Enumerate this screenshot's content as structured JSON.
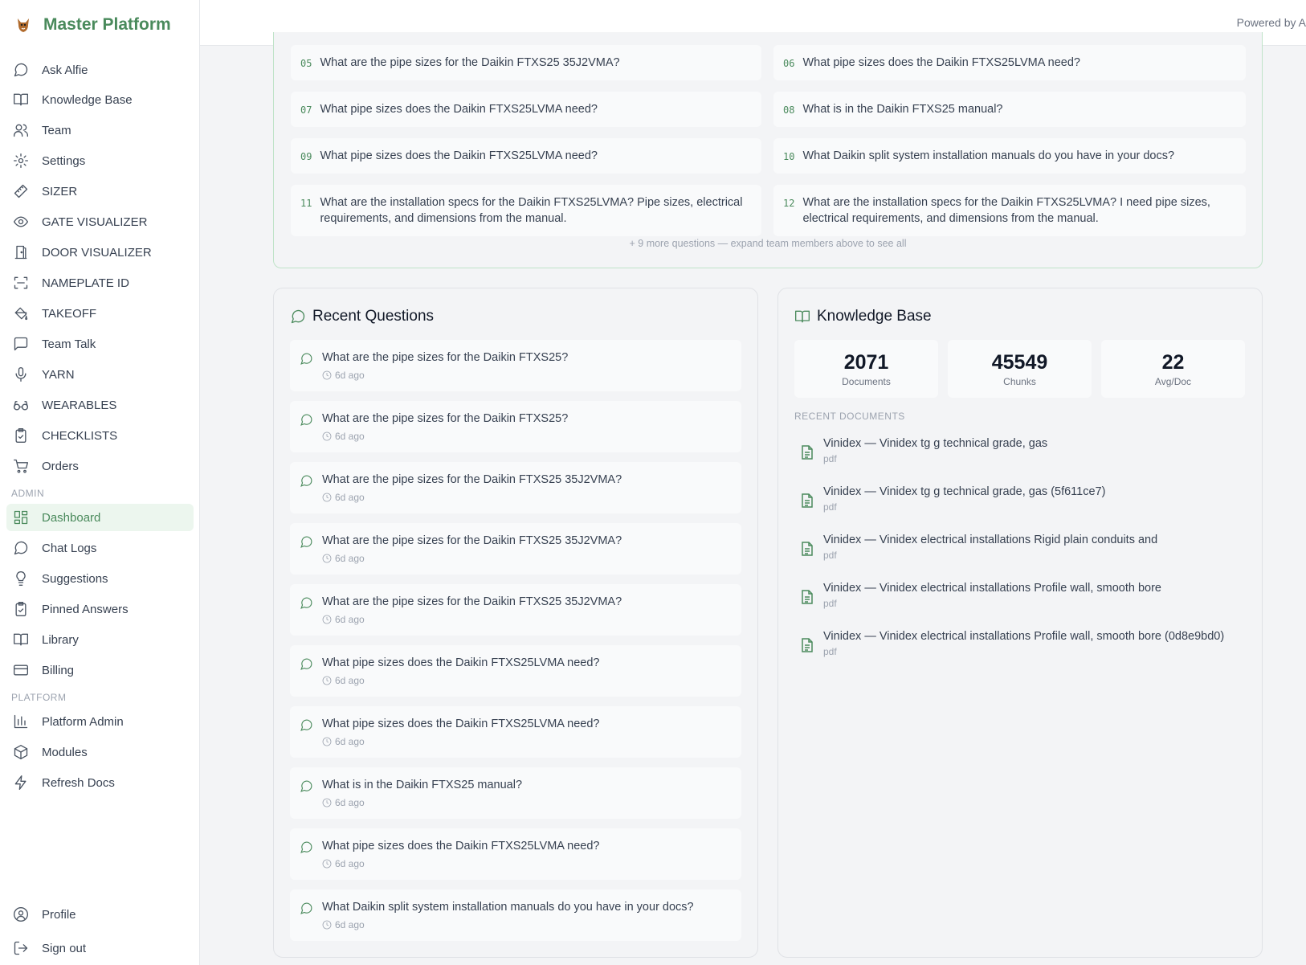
{
  "app": {
    "title": "Master Platform",
    "logo_icon": "fox-mascot-icon"
  },
  "topbar": {
    "powered_by": "Powered by A"
  },
  "sidebar": {
    "items": [
      {
        "label": "Ask Alfie",
        "icon": "chat-bubble-icon"
      },
      {
        "label": "Knowledge Base",
        "icon": "book-open-icon"
      },
      {
        "label": "Team",
        "icon": "users-icon"
      },
      {
        "label": "Settings",
        "icon": "gear-icon"
      },
      {
        "label": "SIZER",
        "icon": "ruler-icon"
      },
      {
        "label": "GATE VISUALIZER",
        "icon": "eye-icon"
      },
      {
        "label": "DOOR VISUALIZER",
        "icon": "door-icon"
      },
      {
        "label": "NAMEPLATE ID",
        "icon": "scan-icon"
      },
      {
        "label": "TAKEOFF",
        "icon": "paint-bucket-icon"
      },
      {
        "label": "Team Talk",
        "icon": "message-square-icon"
      },
      {
        "label": "YARN",
        "icon": "microphone-icon"
      },
      {
        "label": "WEARABLES",
        "icon": "glasses-icon"
      },
      {
        "label": "CHECKLISTS",
        "icon": "clipboard-check-icon"
      },
      {
        "label": "Orders",
        "icon": "cart-icon"
      }
    ],
    "admin_heading": "ADMIN",
    "admin_items": [
      {
        "label": "Dashboard",
        "icon": "dashboard-grid-icon",
        "active": true
      },
      {
        "label": "Chat Logs",
        "icon": "chat-bubble-icon"
      },
      {
        "label": "Suggestions",
        "icon": "lightbulb-icon"
      },
      {
        "label": "Pinned Answers",
        "icon": "clipboard-check-icon"
      },
      {
        "label": "Library",
        "icon": "book-open-icon"
      },
      {
        "label": "Billing",
        "icon": "credit-card-icon"
      }
    ],
    "platform_heading": "PLATFORM",
    "platform_items": [
      {
        "label": "Platform Admin",
        "icon": "bar-chart-icon"
      },
      {
        "label": "Modules",
        "icon": "package-icon"
      },
      {
        "label": "Refresh Docs",
        "icon": "lightning-icon"
      }
    ],
    "footer_items": [
      {
        "label": "Profile",
        "icon": "user-circle-icon"
      },
      {
        "label": "Sign out",
        "icon": "sign-out-icon"
      }
    ]
  },
  "top_questions": {
    "items": [
      {
        "num": "05",
        "text": "What are the pipe sizes for the Daikin FTXS25 35J2VMA?"
      },
      {
        "num": "06",
        "text": "What pipe sizes does the Daikin FTXS25LVMA need?"
      },
      {
        "num": "07",
        "text": "What pipe sizes does the Daikin FTXS25LVMA need?"
      },
      {
        "num": "08",
        "text": "What is in the Daikin FTXS25 manual?"
      },
      {
        "num": "09",
        "text": "What pipe sizes does the Daikin FTXS25LVMA need?"
      },
      {
        "num": "10",
        "text": "What Daikin split system installation manuals do you have in your docs?"
      },
      {
        "num": "11",
        "text": "What are the installation specs for the Daikin FTXS25LVMA? Pipe sizes, electrical requirements, and dimensions from the manual."
      },
      {
        "num": "12",
        "text": "What are the installation specs for the Daikin FTXS25LVMA? I need pipe sizes, electrical requirements, and dimensions from the manual."
      }
    ],
    "more_text": "+ 9 more questions — expand team members above to see all"
  },
  "recent_questions": {
    "title": "Recent Questions",
    "items": [
      {
        "text": "What are the pipe sizes for the Daikin FTXS25?",
        "time": "6d ago"
      },
      {
        "text": "What are the pipe sizes for the Daikin FTXS25?",
        "time": "6d ago"
      },
      {
        "text": "What are the pipe sizes for the Daikin FTXS25 35J2VMA?",
        "time": "6d ago"
      },
      {
        "text": "What are the pipe sizes for the Daikin FTXS25 35J2VMA?",
        "time": "6d ago"
      },
      {
        "text": "What are the pipe sizes for the Daikin FTXS25 35J2VMA?",
        "time": "6d ago"
      },
      {
        "text": "What pipe sizes does the Daikin FTXS25LVMA need?",
        "time": "6d ago"
      },
      {
        "text": "What pipe sizes does the Daikin FTXS25LVMA need?",
        "time": "6d ago"
      },
      {
        "text": "What is in the Daikin FTXS25 manual?",
        "time": "6d ago"
      },
      {
        "text": "What pipe sizes does the Daikin FTXS25LVMA need?",
        "time": "6d ago"
      },
      {
        "text": "What Daikin split system installation manuals do you have in your docs?",
        "time": "6d ago"
      }
    ]
  },
  "knowledge_base": {
    "title": "Knowledge Base",
    "stats": [
      {
        "value": "2071",
        "label": "Documents"
      },
      {
        "value": "45549",
        "label": "Chunks"
      },
      {
        "value": "22",
        "label": "Avg/Doc"
      }
    ],
    "recent_heading": "RECENT DOCUMENTS",
    "documents": [
      {
        "name": "Vinidex — Vinidex tg g technical grade, gas",
        "type": "pdf"
      },
      {
        "name": "Vinidex — Vinidex tg g technical grade, gas (5f611ce7)",
        "type": "pdf"
      },
      {
        "name": "Vinidex — Vinidex electrical installations Rigid plain conduits and",
        "type": "pdf"
      },
      {
        "name": "Vinidex — Vinidex electrical installations Profile wall, smooth bore",
        "type": "pdf"
      },
      {
        "name": "Vinidex — Vinidex electrical installations Profile wall, smooth bore (0d8e9bd0)",
        "type": "pdf"
      }
    ]
  },
  "colors": {
    "accent": "#4a8a5c",
    "active_bg": "#ecf6ee"
  }
}
